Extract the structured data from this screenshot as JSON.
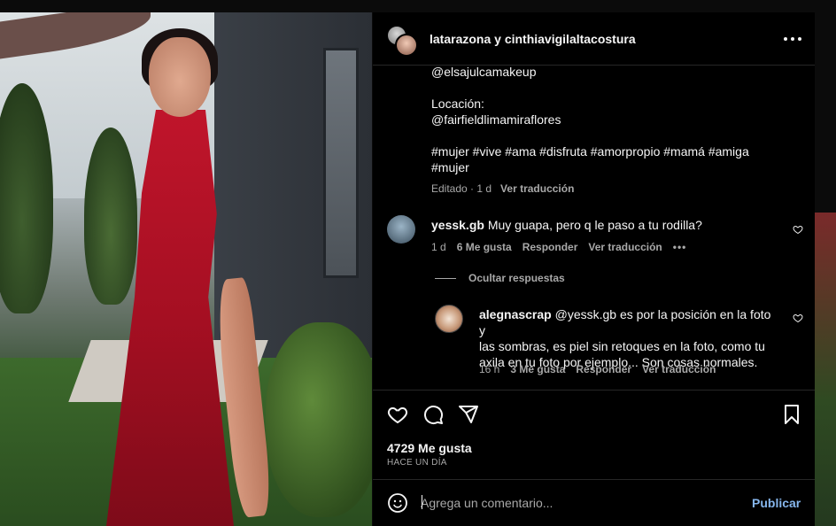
{
  "header": {
    "title": "latarazona y cinthiavigilaltacostura",
    "more_icon": "more-horizontal-icon"
  },
  "caption": {
    "lines": [
      "@elsajulcamakeup",
      "",
      "Locación:",
      "@fairfieldlimamiraflores",
      "",
      "#mujer #vive #ama #disfruta #amorpropio #mamá #amiga",
      "#mujer"
    ],
    "edited": "Editado · 1 d",
    "translate": "Ver traducción"
  },
  "comments": [
    {
      "user": "yessk.gb",
      "text": "Muy guapa, pero q le paso a tu rodilla?",
      "time": "1 d",
      "likes": "6 Me gusta",
      "reply": "Responder",
      "translate": "Ver traducción"
    }
  ],
  "hide_replies": "Ocultar respuestas",
  "replies": [
    {
      "user": "alegnascrap",
      "text_lines": [
        "@yessk.gb es por la posición en la foto y",
        "las sombras, es piel sin retoques en la foto, como tu",
        "axila en tu foto por ejemplo... Son cosas normales."
      ],
      "time": "16 h",
      "likes": "3 Me gusta",
      "reply": "Responder",
      "translate": "Ver traducción"
    }
  ],
  "actions": {
    "icons": [
      "heart-icon",
      "comment-icon",
      "share-icon",
      "bookmark-icon"
    ]
  },
  "likes_count": "4729 Me gusta",
  "posted_when": "HACE UN DÍA",
  "comment_box": {
    "placeholder": "Agrega un comentario...",
    "publish_label": "Publicar"
  },
  "colors": {
    "background": "#000000",
    "text": "#f5f5f5",
    "muted": "#a8a8a8",
    "accent": "#86b6ec",
    "dress": "#c0152b"
  }
}
